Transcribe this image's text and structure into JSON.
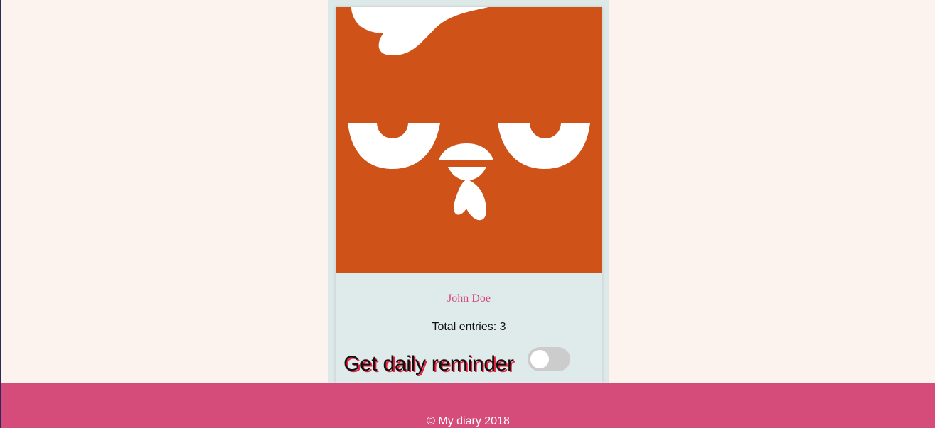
{
  "profile": {
    "avatar_icon": "angry-chicken-avatar",
    "name": "John Doe",
    "entries_label": "Total entries:",
    "entries_count": "3",
    "reminder_label": "Get daily reminder",
    "reminder_enabled": false
  },
  "footer": {
    "copyright": "© My diary 2018"
  },
  "colors": {
    "page_background": "#fcf3ef",
    "panel_background": "#dde9e8",
    "avatar_background": "#cf5219",
    "name_color": "#d54c7b",
    "footer_background": "#d54c7b",
    "toggle_off": "#cccccc",
    "label_shadow": "#e8213f"
  }
}
